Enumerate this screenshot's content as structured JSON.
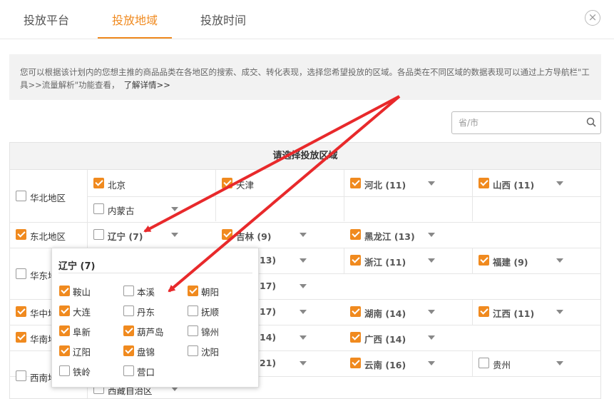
{
  "tabs": [
    {
      "label": "投放平台"
    },
    {
      "label": "投放地域"
    },
    {
      "label": "投放时间"
    }
  ],
  "close_icon": "×",
  "info": {
    "text": "您可以根据该计划内的您想主推的商品品类在各地区的搜索、成交、转化表现，选择您希望投放的区域。各品类在不同区域的数据表现可以通过上方导航栏\"工具>>流量解析\"功能查看，",
    "more": "了解详情>>"
  },
  "search": {
    "placeholder": "省/市"
  },
  "table": {
    "title": "请选择投放区域",
    "regions": [
      {
        "label": "华北地区",
        "checked": false
      },
      {
        "label": "东北地区",
        "checked": true
      },
      {
        "label": "华东地区",
        "checked": false
      },
      {
        "label": "华中地区",
        "checked": true
      },
      {
        "label": "华南地区",
        "checked": true
      },
      {
        "label": "西南地区",
        "checked": false
      }
    ],
    "provinces": [
      {
        "label": "北京",
        "checked": true
      },
      {
        "label": "天津",
        "checked": true
      },
      {
        "label": "河北 (11)",
        "checked": true
      },
      {
        "label": "山西 (11)",
        "checked": true
      },
      {
        "label": "内蒙古",
        "checked": false
      },
      {
        "label": "辽宁 (7)",
        "checked": false
      },
      {
        "label": "吉林 (9)",
        "checked": true
      },
      {
        "label": "黑龙江 (13)",
        "checked": true
      },
      {
        "label": "13)",
        "checked": null
      },
      {
        "label": "浙江 (11)",
        "checked": true
      },
      {
        "label": "福建 (9)",
        "checked": true
      },
      {
        "label": "17)",
        "checked": null
      },
      {
        "label": "17)",
        "checked": null
      },
      {
        "label": "湖南 (14)",
        "checked": true
      },
      {
        "label": "江西 (11)",
        "checked": true
      },
      {
        "label": "14)",
        "checked": null
      },
      {
        "label": "广西 (14)",
        "checked": true
      },
      {
        "label": "21)",
        "checked": null
      },
      {
        "label": "云南 (16)",
        "checked": true
      },
      {
        "label": "贵州",
        "checked": false
      },
      {
        "label": "西藏自治区",
        "checked": false
      }
    ]
  },
  "popup": {
    "title": "辽宁 (7)",
    "cities": [
      {
        "label": "鞍山",
        "checked": true
      },
      {
        "label": "本溪",
        "checked": false
      },
      {
        "label": "朝阳",
        "checked": true
      },
      {
        "label": "大连",
        "checked": true
      },
      {
        "label": "丹东",
        "checked": false
      },
      {
        "label": "抚顺",
        "checked": false
      },
      {
        "label": "阜新",
        "checked": true
      },
      {
        "label": "葫芦岛",
        "checked": true
      },
      {
        "label": "锦州",
        "checked": false
      },
      {
        "label": "辽阳",
        "checked": true
      },
      {
        "label": "盘锦",
        "checked": true
      },
      {
        "label": "沈阳",
        "checked": false
      },
      {
        "label": "铁岭",
        "checked": false
      },
      {
        "label": "营口",
        "checked": false
      }
    ]
  },
  "colors": {
    "accent": "#f08a1f",
    "arrow": "#e8292b"
  }
}
